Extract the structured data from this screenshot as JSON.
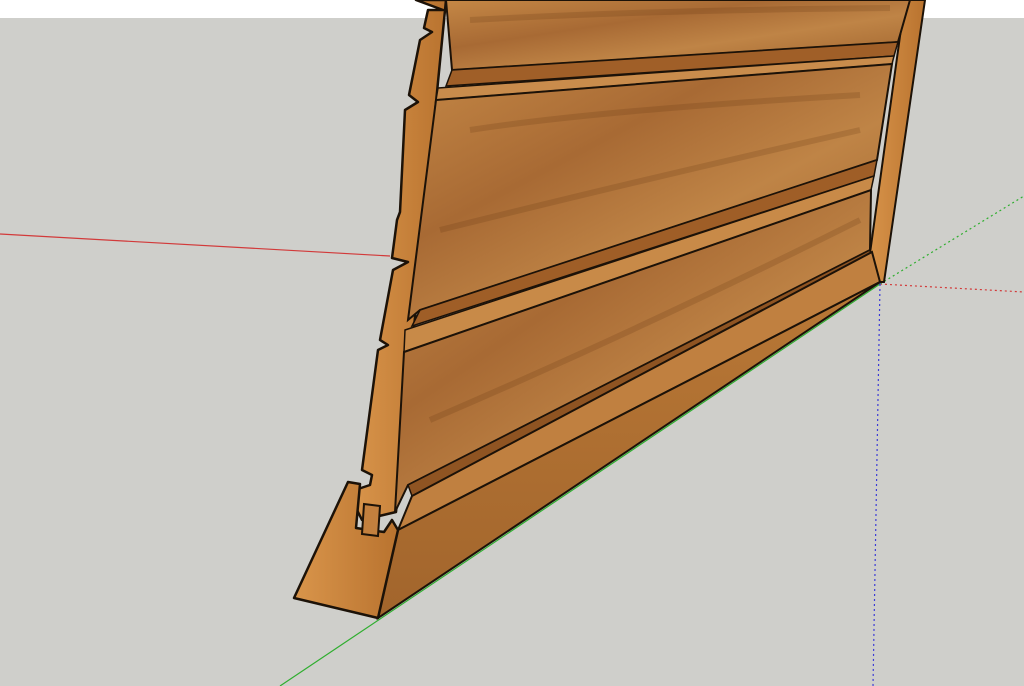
{
  "viewport": {
    "sky_color": "#ffffff",
    "ground_color": "#cfcfcb"
  },
  "axes": {
    "red_axis_color": "#d23a3a",
    "green_axis_color": "#2fae2f",
    "blue_axis_color": "#3a3ad6"
  },
  "model": {
    "wood_light": "#c98a45",
    "wood_mid": "#b06f32",
    "wood_dark": "#8a5020",
    "edge_color": "#1c1208"
  }
}
